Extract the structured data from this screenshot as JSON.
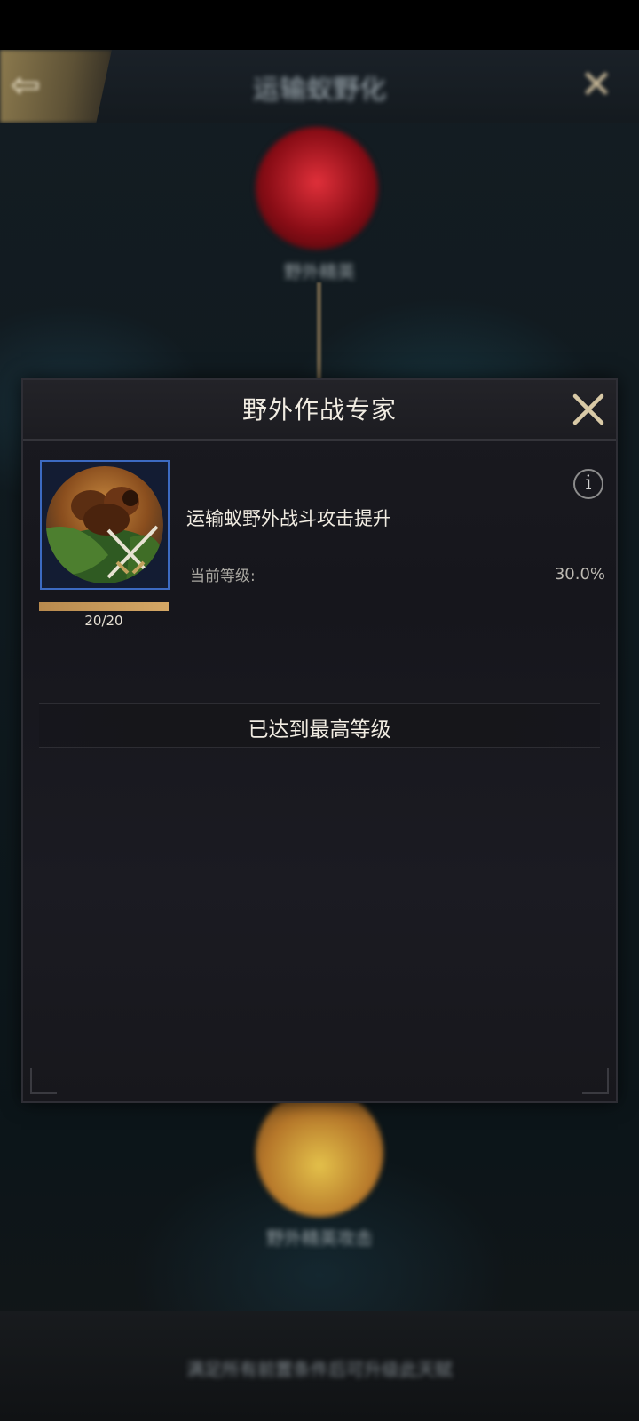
{
  "background": {
    "title": "运输蚁野化",
    "node_top_label": "野外精英",
    "node_bottom_label": "野外精英攻击",
    "footer_text": "满足所有前置条件后可升级此天赋"
  },
  "dialog": {
    "title": "野外作战专家",
    "skill": {
      "icon_name": "ant-crossed-swords-icon",
      "description": "运输蚁野外战斗攻击提升",
      "progress_text": "20/20",
      "progress_fraction": 1.0,
      "current_level_label": "当前等级:",
      "current_level_value": "30.0%"
    },
    "max_level_text": "已达到最高等级"
  },
  "colors": {
    "accent_gold": "#c9a86a",
    "icon_border_blue": "#3c6ac2",
    "progress_fill": "#c99a5a"
  }
}
